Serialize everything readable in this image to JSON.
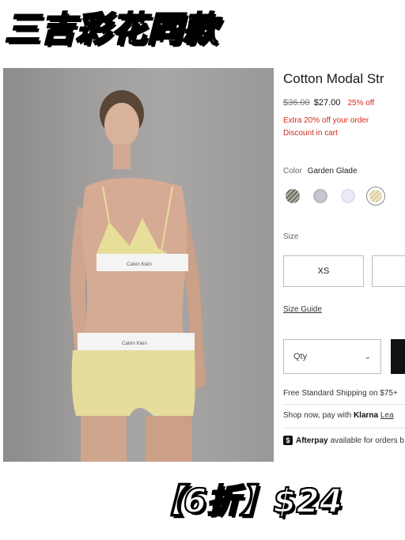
{
  "banner": {
    "title": "三吉彩花同款"
  },
  "product": {
    "title": "Cotton Modal Str",
    "price_original": "$36.00",
    "price_sale": "$27.00",
    "discount": "25% off",
    "promo_line1": "Extra 20% off your order",
    "promo_line2": "Discount in cart",
    "brand_band_text": "Calvin Klein"
  },
  "color": {
    "label": "Color",
    "selected": "Garden Glade",
    "swatches": [
      "grey-stripe",
      "lavender-grey",
      "light-lilac",
      "garden-glade"
    ],
    "selected_index": 3
  },
  "size": {
    "label": "Size",
    "options": [
      "XS",
      ""
    ],
    "guide_link": "Size Guide"
  },
  "quantity": {
    "placeholder": "Qty"
  },
  "shipping": {
    "text": "Free Standard Shipping on $75+"
  },
  "klarna": {
    "prefix": "Shop now, pay with",
    "brand": "Klarna",
    "link": "Lea"
  },
  "afterpay": {
    "icon": "$",
    "brand": "Afterpay",
    "text": "available for orders b"
  },
  "bottom_banner": {
    "text": "【6折】$24"
  }
}
